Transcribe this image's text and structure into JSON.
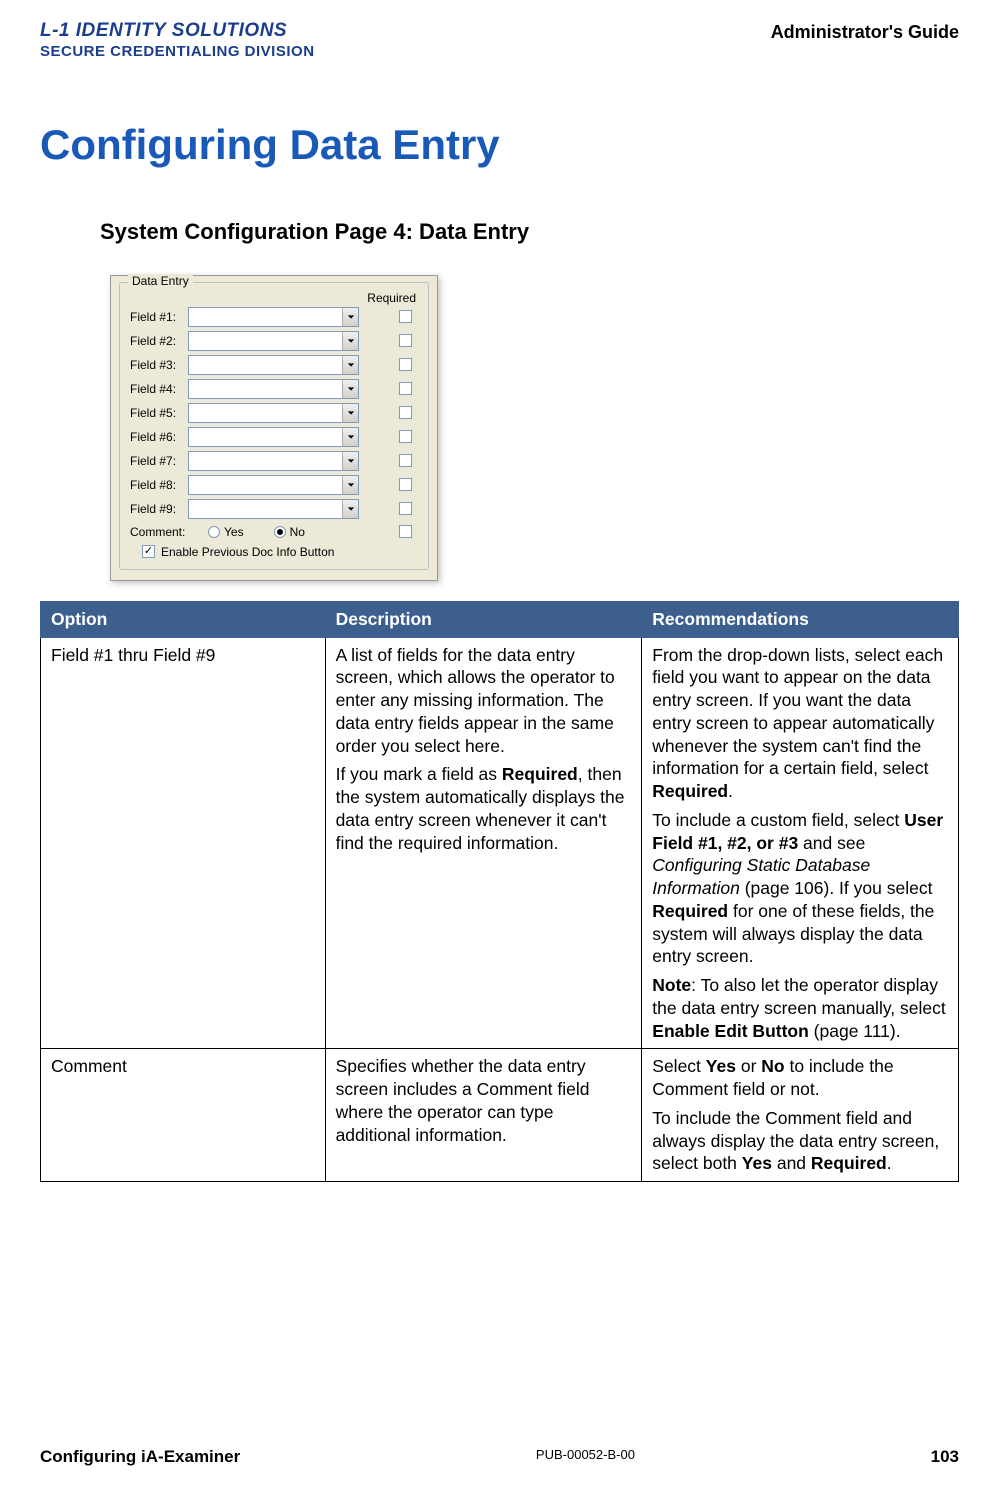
{
  "header": {
    "logo_line1": "L-1 IDENTITY SOLUTIONS",
    "logo_line2": "SECURE CREDENTIALING DIVISION",
    "guide_title": "Administrator's Guide"
  },
  "main_heading": "Configuring Data Entry",
  "sub_heading": "System Configuration Page 4: Data Entry",
  "screenshot": {
    "legend": "Data Entry",
    "required_header": "Required",
    "fields": [
      {
        "label": "Field #1:"
      },
      {
        "label": "Field #2:"
      },
      {
        "label": "Field #3:"
      },
      {
        "label": "Field #4:"
      },
      {
        "label": "Field #5:"
      },
      {
        "label": "Field #6:"
      },
      {
        "label": "Field #7:"
      },
      {
        "label": "Field #8:"
      },
      {
        "label": "Field #9:"
      }
    ],
    "comment_label": "Comment:",
    "yes_label": "Yes",
    "no_label": "No",
    "enable_label": "Enable Previous Doc Info Button"
  },
  "table": {
    "headers": {
      "option": "Option",
      "description": "Description",
      "recommendations": "Recommendations"
    },
    "rows": [
      {
        "option": "Field #1 thru Field #9",
        "desc_p1": "A list of fields for the data entry screen, which allows the operator to enter any missing information. The data entry fields appear in the same order you select here.",
        "desc_p2a": "If you mark a field as ",
        "desc_p2_bold": "Required",
        "desc_p2b": ", then the system automatically displays the data entry screen whenever it can't find the required information.",
        "rec_p1a": "From the drop-down lists, select each field you want to appear on the data entry screen. If you want the data entry screen to appear automatically whenever the system can't find the information for a certain field, select ",
        "rec_p1_bold": "Required",
        "rec_p1b": ".",
        "rec_p2a": "To include a custom field, select ",
        "rec_p2_bold1": "User Field #1, #2, or #3",
        "rec_p2b": " and see ",
        "rec_p2_ital": "Configuring Static Database Information",
        "rec_p2c": " (page 106). If you select ",
        "rec_p2_bold2": "Required",
        "rec_p2d": " for one of these fields, the system will always display the data entry screen.",
        "rec_p3_bold1": "Note",
        "rec_p3a": ": To also let the operator display the data entry screen manually, select ",
        "rec_p3_bold2": "Enable Edit Button",
        "rec_p3b": " (page 111)."
      },
      {
        "option": "Comment",
        "desc_p1": "Specifies whether the data entry screen includes a Comment field where the operator can type additional information.",
        "rec_p1a": "Select ",
        "rec_p1_bold1": "Yes",
        "rec_p1b": " or ",
        "rec_p1_bold2": "No",
        "rec_p1c": " to include the Comment field or not.",
        "rec_p2a": "To include the Comment field and always display the data entry screen, select both ",
        "rec_p2_bold1": "Yes",
        "rec_p2b": " and ",
        "rec_p2_bold2": "Required",
        "rec_p2c": "."
      }
    ]
  },
  "footer": {
    "left": "Configuring iA-Examiner",
    "mid": "PUB-00052-B-00",
    "right": "103"
  }
}
